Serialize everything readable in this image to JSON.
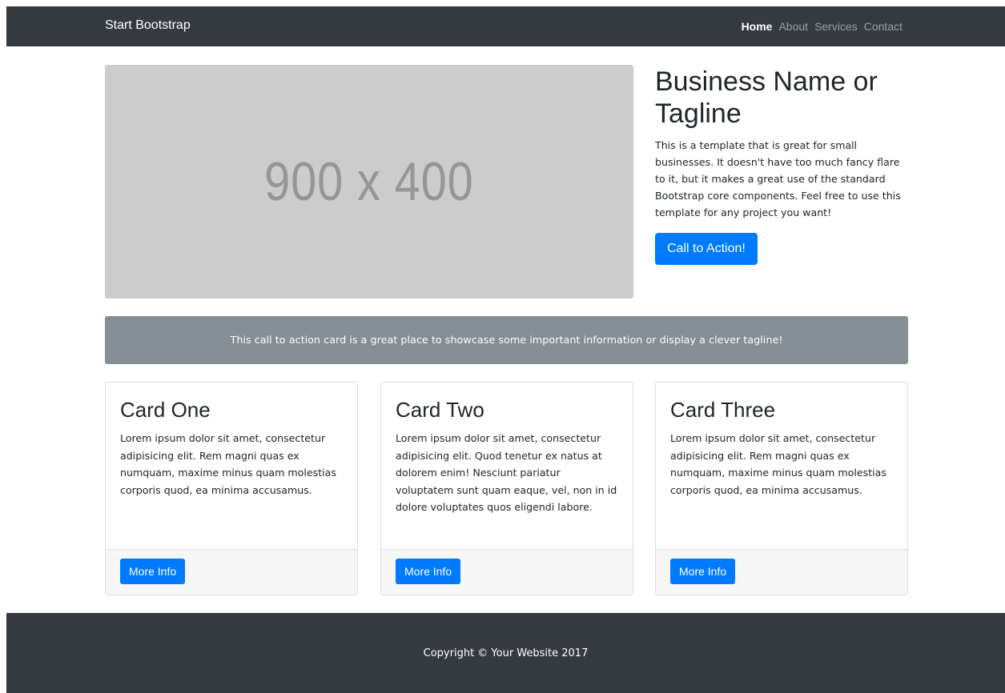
{
  "navbar": {
    "brand": "Start Bootstrap",
    "links": [
      {
        "label": "Home",
        "active": true
      },
      {
        "label": "About",
        "active": false
      },
      {
        "label": "Services",
        "active": false
      },
      {
        "label": "Contact",
        "active": false
      }
    ]
  },
  "hero": {
    "image_placeholder": "900 x 400",
    "title": "Business Name or Tagline",
    "description": "This is a template that is great for small businesses. It doesn't have too much fancy flare to it, but it makes a great use of the standard Bootstrap core components. Feel free to use this template for any project you want!",
    "cta_label": "Call to Action!"
  },
  "callout": {
    "text": "This call to action card is a great place to showcase some important information or display a clever tagline!"
  },
  "cards": [
    {
      "title": "Card One",
      "text": "Lorem ipsum dolor sit amet, consectetur adipisicing elit. Rem magni quas ex numquam, maxime minus quam molestias corporis quod, ea minima accusamus.",
      "button": "More Info"
    },
    {
      "title": "Card Two",
      "text": "Lorem ipsum dolor sit amet, consectetur adipisicing elit. Quod tenetur ex natus at dolorem enim! Nesciunt pariatur voluptatem sunt quam eaque, vel, non in id dolore voluptates quos eligendi labore.",
      "button": "More Info"
    },
    {
      "title": "Card Three",
      "text": "Lorem ipsum dolor sit amet, consectetur adipisicing elit. Rem magni quas ex numquam, maxime minus quam molestias corporis quod, ea minima accusamus.",
      "button": "More Info"
    }
  ],
  "footer": {
    "text": "Copyright © Your Website 2017"
  },
  "colors": {
    "navbar_bg": "#343a40",
    "primary": "#007bff",
    "callout_bg": "#868e96",
    "placeholder_bg": "#cccccc"
  }
}
